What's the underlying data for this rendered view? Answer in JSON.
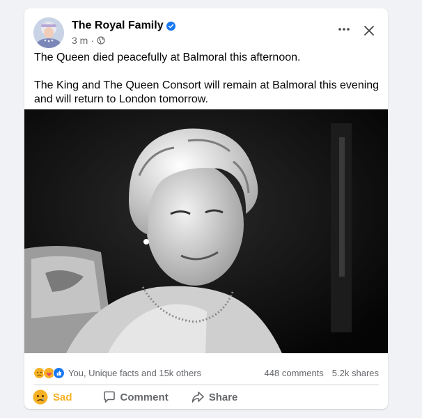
{
  "post": {
    "page_name": "The Royal Family",
    "time": "3 m",
    "separator": "·",
    "paragraphs": [
      "The Queen died peacefully at Balmoral this afternoon.",
      "The King and The Queen Consort will remain at Balmoral this evening and will return to London tomorrow."
    ]
  },
  "icons": {
    "verified": "verified-badge-icon",
    "audience": "globe-icon",
    "more": "more-options-icon",
    "close": "close-icon"
  },
  "stats": {
    "reactions_text": "You, Unique facts and 15k others",
    "comments": "448 comments",
    "shares": "5.2k shares"
  },
  "actions": {
    "sad": "Sad",
    "comment": "Comment",
    "share": "Share"
  },
  "colors": {
    "background": "#f0f2f5",
    "card": "#ffffff",
    "verified_blue": "#1877f2",
    "secondary_text": "#65676b",
    "sad_yellow": "#f7b125"
  }
}
